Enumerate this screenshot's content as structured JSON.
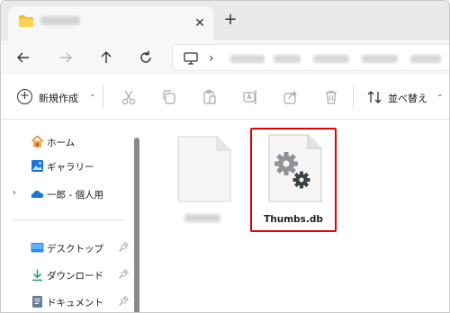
{
  "tab": {
    "close_glyph": "✕",
    "new_tab_glyph": "+"
  },
  "address": {
    "separator": "›"
  },
  "toolbar": {
    "new_label": "新規作成",
    "new_caret": "⌄",
    "sort_label": "並べ替え",
    "sort_caret": "⌄"
  },
  "sidebar": {
    "items": [
      {
        "label": "ホーム",
        "icon": "home-icon"
      },
      {
        "label": "ギャラリー",
        "icon": "gallery-icon"
      },
      {
        "label": "一郎 - 個人用",
        "icon": "cloud-icon",
        "expand": "›"
      },
      {
        "label": "デスクトップ",
        "icon": "desktop-icon",
        "pinned": true
      },
      {
        "label": "ダウンロード",
        "icon": "download-icon",
        "pinned": true
      },
      {
        "label": "ドキュメント",
        "icon": "documents-icon",
        "pinned": true
      }
    ]
  },
  "files": [
    {
      "name": "",
      "icon": "document-icon",
      "selected": false
    },
    {
      "name": "Thumbs.db",
      "icon": "settings-file-icon",
      "selected": true
    }
  ],
  "colors": {
    "selection_border": "#e30000",
    "folder": "#f4c230",
    "accent_blue": "#1a73d9"
  }
}
